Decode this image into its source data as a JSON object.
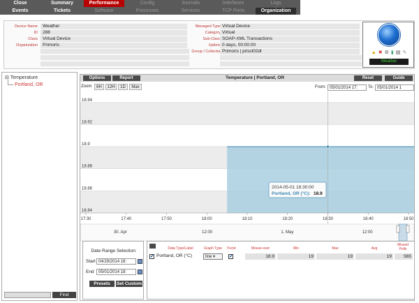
{
  "nav": {
    "row1": [
      "Close",
      "Summary",
      "Performance",
      "Config",
      "Journals",
      "Interfaces",
      "Logs"
    ],
    "row2": [
      "Events",
      "Tickets",
      "Software",
      "Processes",
      "Services",
      "TCP Ports",
      "Organization"
    ]
  },
  "device": {
    "left": [
      {
        "label": "Device Name",
        "value": "Weather"
      },
      {
        "label": "ID",
        "value": "288"
      },
      {
        "label": "Class",
        "value": "Virtual Device"
      },
      {
        "label": "Organization",
        "value": "Primoris"
      }
    ],
    "right": [
      {
        "label": "Managed Type",
        "value": "Virtual Device"
      },
      {
        "label": "Category",
        "value": "Virtual"
      },
      {
        "label": "Sub-Class",
        "value": "SOAP-XML Transactions"
      },
      {
        "label": "Uptime",
        "value": "0 days, 00:00:00"
      },
      {
        "label": "Group / Collector",
        "value": "Primoris | priscl02dl"
      }
    ],
    "badge": "Weather"
  },
  "tree": {
    "root": "Temperature",
    "child": "Portland, OR",
    "find_label": "Find"
  },
  "panel": {
    "options": "Options",
    "report": "Report",
    "title": "Temperature | Portland, OR",
    "reset": "Reset",
    "guide": "Guide",
    "zoom_label": "Zoom",
    "zoom_buttons": [
      "6H",
      "12H",
      "1D",
      "Max"
    ],
    "from_label": "From:",
    "from_value": "05/01/2014 17:",
    "to_label": "To:",
    "to_value": "05/01/2014 1"
  },
  "chart_data": {
    "type": "area",
    "y_ticks": [
      "18.94",
      "18.92",
      "18.9",
      "18.88",
      "18.86",
      "18.84"
    ],
    "x_ticks": [
      "17:30",
      "17:40",
      "17:50",
      "18:00",
      "18:10",
      "18:20",
      "18:30",
      "18:40",
      "18:50"
    ],
    "nav_labels": [
      "30. Apr",
      "12:00",
      "1. May",
      "12:00"
    ],
    "series": [
      {
        "name": "Portland, OR (°C)",
        "x": [
          "18:05",
          "18:30",
          "18:50"
        ],
        "values": [
          18.9,
          18.9,
          18.9
        ]
      }
    ],
    "tooltip": {
      "time": "2014-05-01 18:30:00",
      "series": "Portland, OR (°C):",
      "value": "18.9"
    },
    "ylim": [
      18.84,
      18.95
    ],
    "colors": {
      "area": "#a9cfe0",
      "line": "#3a86b0"
    }
  },
  "range": {
    "title": "Date Range Selection:",
    "start_label": "Start",
    "start_value": "04/29/2014 18:",
    "end_label": "End",
    "end_value": "05/01/2014 18:",
    "presets": "Presets",
    "set_custom": "Set Custom"
  },
  "grid": {
    "headers": [
      "Data Type/Label",
      "Graph Type",
      "Trend",
      "Mouse-over",
      "Min",
      "Max",
      "Avg",
      "Missed Polls"
    ],
    "row": {
      "label": "Portland, OR (°C)",
      "graph_type": "line",
      "mouse_over": "18.9",
      "min": "19",
      "max": "19",
      "avg": "19",
      "missed": "565"
    }
  }
}
